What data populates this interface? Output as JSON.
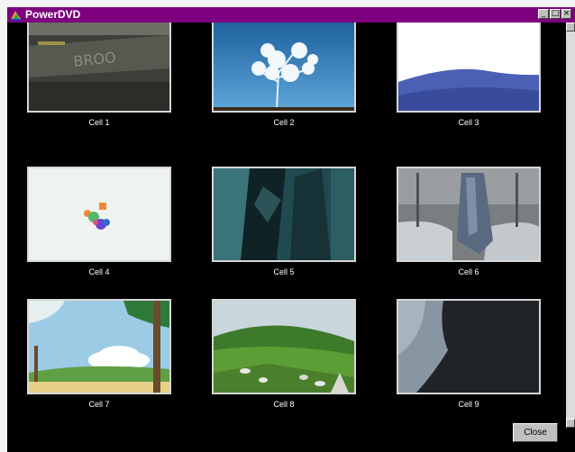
{
  "window": {
    "title": "PowerDVD",
    "minimize_glyph": "_",
    "maximize_glyph": "□",
    "close_glyph": "×"
  },
  "cells": [
    {
      "label": "Cell 1",
      "thumbnail": "blurry-brick-sign-scene"
    },
    {
      "label": "Cell 2",
      "thumbnail": "frosted-tree-blue-sky"
    },
    {
      "label": "Cell 3",
      "thumbnail": "white-frame-blue-dune"
    },
    {
      "label": "Cell 4",
      "thumbnail": "colorful-abstract-shape"
    },
    {
      "label": "Cell 5",
      "thumbnail": "dark-teal-figures"
    },
    {
      "label": "Cell 6",
      "thumbnail": "hanging-cloth-bales"
    },
    {
      "label": "Cell 7",
      "thumbnail": "cartoon-landscape"
    },
    {
      "label": "Cell 8",
      "thumbnail": "green-hills-sheep"
    },
    {
      "label": "Cell 9",
      "thumbnail": "dark-scene-left-light"
    }
  ],
  "close_button": {
    "label": "Close"
  }
}
